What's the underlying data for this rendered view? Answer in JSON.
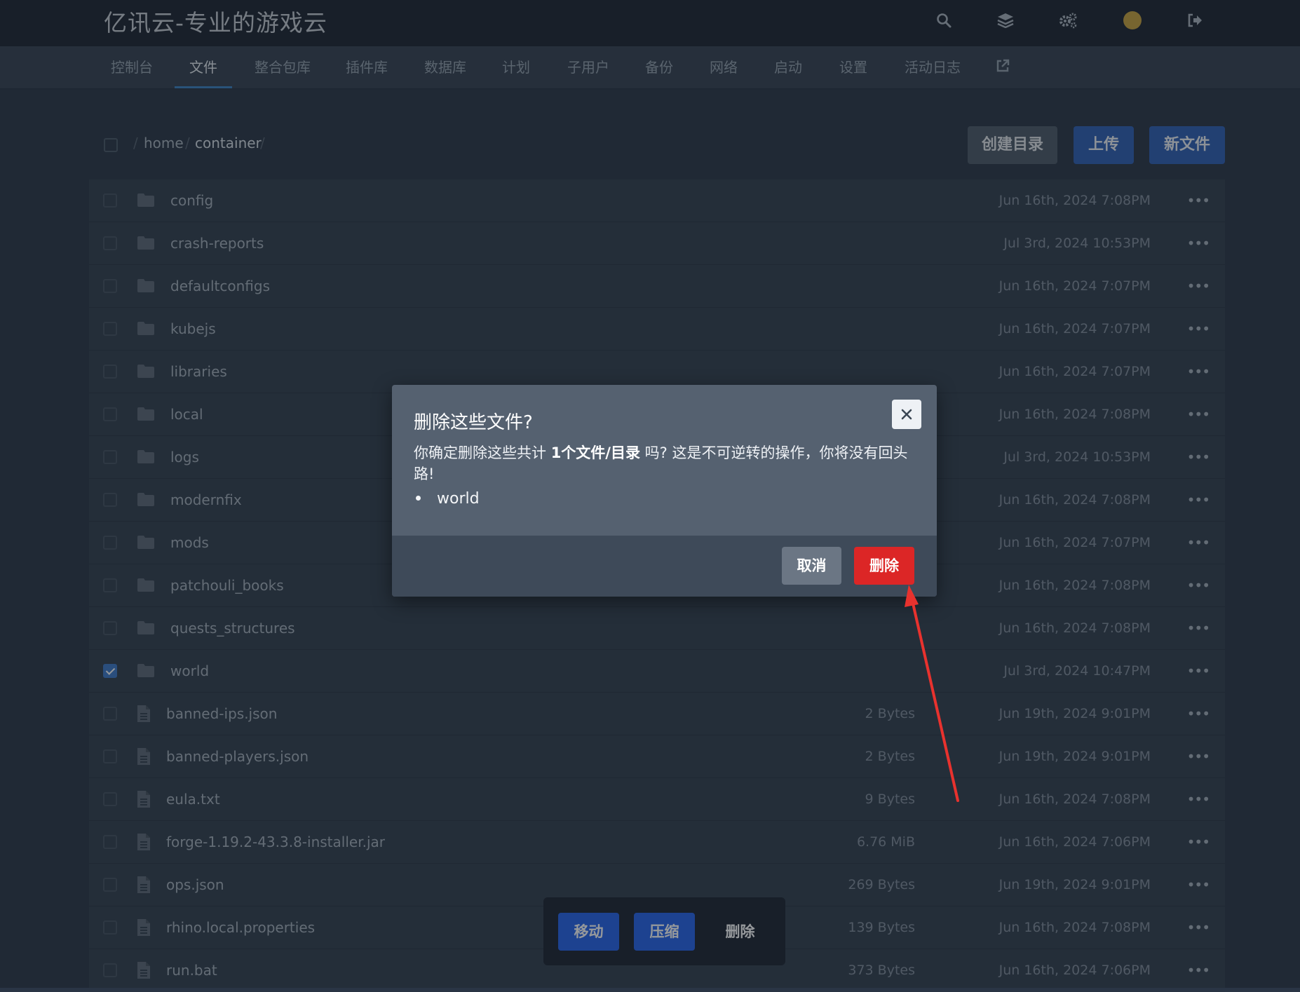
{
  "header": {
    "brand": "亿讯云-专业的游戏云",
    "icons": [
      "search-icon",
      "layers-icon",
      "gears-icon",
      "avatar",
      "logout-icon"
    ]
  },
  "nav": {
    "items": [
      {
        "label": "控制台"
      },
      {
        "label": "文件",
        "active": true
      },
      {
        "label": "整合包库"
      },
      {
        "label": "插件库"
      },
      {
        "label": "数据库"
      },
      {
        "label": "计划"
      },
      {
        "label": "子用户"
      },
      {
        "label": "备份"
      },
      {
        "label": "网络"
      },
      {
        "label": "启动"
      },
      {
        "label": "设置"
      },
      {
        "label": "活动日志"
      }
    ],
    "external_icon": "external-link-icon"
  },
  "breadcrumb": {
    "sep": "/",
    "home": "home",
    "current": "container"
  },
  "toolbar": {
    "create_dir": "创建目录",
    "upload": "上传",
    "new_file": "新文件"
  },
  "files": [
    {
      "name": "config",
      "type": "folder",
      "size": "",
      "date": "Jun 16th, 2024 7:08PM",
      "checked": false
    },
    {
      "name": "crash-reports",
      "type": "folder",
      "size": "",
      "date": "Jul 3rd, 2024 10:53PM",
      "checked": false
    },
    {
      "name": "defaultconfigs",
      "type": "folder",
      "size": "",
      "date": "Jun 16th, 2024 7:07PM",
      "checked": false
    },
    {
      "name": "kubejs",
      "type": "folder",
      "size": "",
      "date": "Jun 16th, 2024 7:07PM",
      "checked": false
    },
    {
      "name": "libraries",
      "type": "folder",
      "size": "",
      "date": "Jun 16th, 2024 7:07PM",
      "checked": false
    },
    {
      "name": "local",
      "type": "folder",
      "size": "",
      "date": "Jun 16th, 2024 7:08PM",
      "checked": false
    },
    {
      "name": "logs",
      "type": "folder",
      "size": "",
      "date": "Jul 3rd, 2024 10:53PM",
      "checked": false
    },
    {
      "name": "modernfix",
      "type": "folder",
      "size": "",
      "date": "Jun 16th, 2024 7:08PM",
      "checked": false
    },
    {
      "name": "mods",
      "type": "folder",
      "size": "",
      "date": "Jun 16th, 2024 7:07PM",
      "checked": false
    },
    {
      "name": "patchouli_books",
      "type": "folder",
      "size": "",
      "date": "Jun 16th, 2024 7:08PM",
      "checked": false
    },
    {
      "name": "quests_structures",
      "type": "folder",
      "size": "",
      "date": "Jun 16th, 2024 7:08PM",
      "checked": false
    },
    {
      "name": "world",
      "type": "folder",
      "size": "",
      "date": "Jul 3rd, 2024 10:47PM",
      "checked": true
    },
    {
      "name": "banned-ips.json",
      "type": "file",
      "size": "2 Bytes",
      "date": "Jun 19th, 2024 9:01PM",
      "checked": false
    },
    {
      "name": "banned-players.json",
      "type": "file",
      "size": "2 Bytes",
      "date": "Jun 19th, 2024 9:01PM",
      "checked": false
    },
    {
      "name": "eula.txt",
      "type": "file",
      "size": "9 Bytes",
      "date": "Jun 16th, 2024 7:08PM",
      "checked": false
    },
    {
      "name": "forge-1.19.2-43.3.8-installer.jar",
      "type": "file",
      "size": "6.76 MiB",
      "date": "Jun 16th, 2024 7:06PM",
      "checked": false
    },
    {
      "name": "ops.json",
      "type": "file",
      "size": "269 Bytes",
      "date": "Jun 19th, 2024 9:01PM",
      "checked": false
    },
    {
      "name": "rhino.local.properties",
      "type": "file",
      "size": "139 Bytes",
      "date": "Jun 16th, 2024 7:08PM",
      "checked": false
    },
    {
      "name": "run.bat",
      "type": "file",
      "size": "373 Bytes",
      "date": "Jun 16th, 2024 7:06PM",
      "checked": false
    }
  ],
  "more_label": "•••",
  "modal": {
    "title": "删除这些文件?",
    "body_pre": "你确定删除这些共计 ",
    "body_bold": "1个文件/目录",
    "body_post": " 吗? 这是不可逆转的操作，你将没有回头路!",
    "items": [
      "world"
    ],
    "cancel": "取消",
    "confirm": "删除"
  },
  "bulk_actions": {
    "move": "移动",
    "compress": "压缩",
    "delete": "删除"
  },
  "colors": {
    "primary": "#2563eb",
    "danger": "#dc2626",
    "annotation": "#e8322e"
  }
}
